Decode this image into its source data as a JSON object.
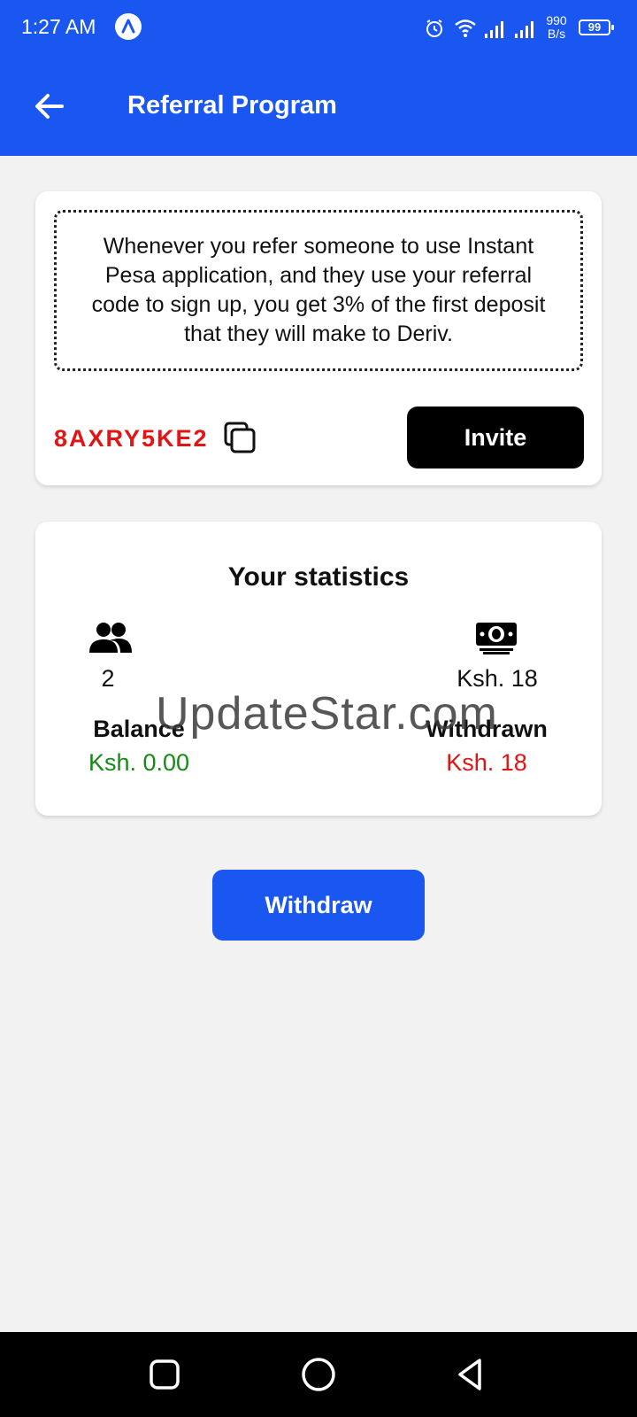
{
  "status_bar": {
    "time": "1:27 AM",
    "net_speed_value": "990",
    "net_speed_unit": "B/s",
    "battery": "99"
  },
  "header": {
    "title": "Referral Program",
    "back_icon": "arrow-left-icon"
  },
  "referral": {
    "description": "Whenever you refer someone to use Instant Pesa application, and they use your referral code to sign up, you get 3% of the first deposit that they will make to Deriv.",
    "code": "8AXRY5KE2",
    "copy_icon": "copy-icon",
    "invite_label": "Invite"
  },
  "statistics": {
    "title": "Your statistics",
    "referrals_icon": "people-icon",
    "referrals_count": "2",
    "earned_icon": "money-icon",
    "earned_amount": "Ksh. 18",
    "balance_label": "Balance",
    "balance_value": "Ksh. 0.00",
    "withdrawn_label": "Withdrawn",
    "withdrawn_value": "Ksh. 18"
  },
  "watermark": "UpdateStar.com",
  "withdraw_label": "Withdraw",
  "colors": {
    "primary": "#1a56f0",
    "code_red": "#e01515",
    "balance_green": "#168a16",
    "withdrawn_red": "#e01515"
  },
  "nav": {
    "recents_icon": "square-icon",
    "home_icon": "circle-icon",
    "back_icon": "triangle-back-icon"
  }
}
